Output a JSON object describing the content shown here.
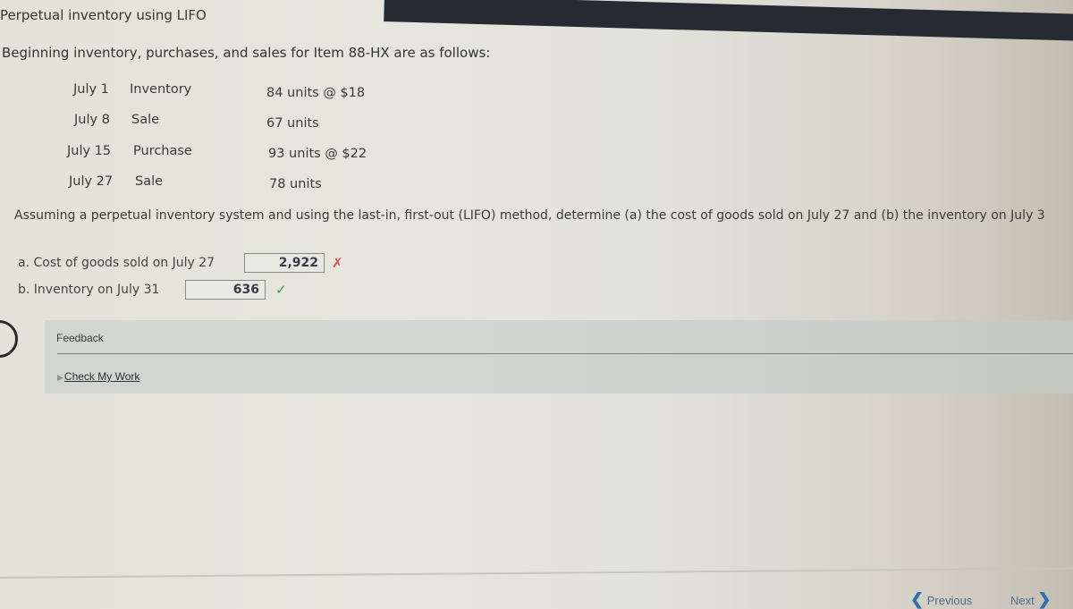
{
  "title": {
    "prefix": "Perpetual inventory using",
    "method": "LIFO"
  },
  "intro": "Beginning inventory, purchases, and sales for Item 88-HX are as follows:",
  "transactions": [
    {
      "date": "July 1",
      "type": "Inventory",
      "detail": "84 units @ $18"
    },
    {
      "date": "July 8",
      "type": "Sale",
      "detail": "67 units"
    },
    {
      "date": "July 15",
      "type": "Purchase",
      "detail": "93 units @ $22"
    },
    {
      "date": "July 27",
      "type": "Sale",
      "detail": "78 units"
    }
  ],
  "question": "Assuming a perpetual inventory system and using the last-in, first-out (LIFO) method, determine (a) the cost of goods sold on July 27 and (b) the inventory on July 3",
  "answers": [
    {
      "label": "a. Cost of goods sold on July 27",
      "value": "2,922",
      "status": "incorrect",
      "mark": "✗"
    },
    {
      "label": "b. Inventory on July 31",
      "value": "636",
      "status": "correct",
      "mark": "✓"
    }
  ],
  "feedback": {
    "label": "Feedback",
    "check_my_work": "Check My Work",
    "expand_icon": "▶"
  },
  "nav": {
    "previous_label": "Previous",
    "next_label": "Next",
    "previous_icon": "❮",
    "next_icon": "❯"
  },
  "colors": {
    "incorrect": "#d9534f",
    "correct": "#3a9a3a",
    "nav_accent": "#2f6fb6"
  }
}
